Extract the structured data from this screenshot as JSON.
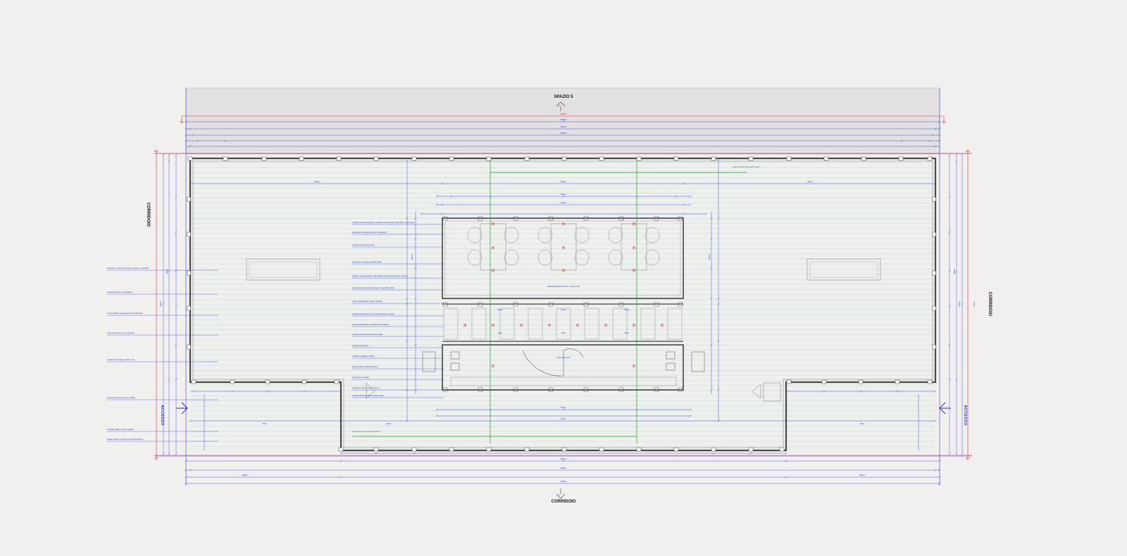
{
  "plan": {
    "labels": {
      "top": "SPAZIO 5",
      "bottom": "CORRIDOIO",
      "left": "CORRIDOIO",
      "right": "CORRIDOIO",
      "access_left": "ACCESSO",
      "access_right": "ACCESSO",
      "section_marker": "A",
      "room_center": "SPAZIO ESPOSITIVO / SALOTTO",
      "room_lower": "RIPOSTIGLIO"
    },
    "dimensions": {
      "overall_width": "1690cm",
      "overall_width_red": "1690cm",
      "inner_width": "1660cm",
      "inner_width_2": "1630cm",
      "left_span": "420cm",
      "center_span": "560cm",
      "right_span": "420cm",
      "bottom_left": "1820cm",
      "bottom_right": "1690cm",
      "height_total": "792cm",
      "height_inner": "748cm",
      "height_red": "800cm",
      "margin_small": "20cm",
      "module": "120cm",
      "module_b": "90cm",
      "module_c": "60cm",
      "stand_width": "560cm",
      "stand_inner": "520cm",
      "stand_depth": "330cm",
      "table_gap": "100cm"
    },
    "notes_left": [
      "pannello in lamiera forata / pannello in Green Arte / pannello in Green Arte",
      "pavimento in Ecoway (finiture metalliche)",
      "mobile pensile con luci led",
      "pavimento in rovere naturale chiaro",
      "parete in vetro pannello a filo Abitat con elementi di telaio in legno",
      "lamiera di rivestimento ignifuga / colore RAL 9003",
      "tavolo rettangolare in legno naturale",
      "rivestimento acustico per pannelli divisori a parete",
      "seduta polipropilene e acciaio colore bianco",
      "lampade da tavolo a led dimmerabili",
      "armadio a due ante",
      "scaffale modulare in legno",
      "tenda a rullo in tessuto tecnico",
      "corrimano in acciaio",
      "struttura a rullo in tessuto tecnico",
      "pannello fonoassorbente colore grigio"
    ],
    "notes_far_left": [
      "pavimento in tavole di rovere naturale cm 20x200",
      "parete divisoria in cartongesso",
      "controsoffitto in cartongesso con faretti led",
      "porta scorrevole in vetro satinato",
      "rivestimento in legno colore noce",
      "illuminazione lineare led a soffitto",
      "pannello grafico stampa digitale",
      "parete a telaio in legno con tamponamento"
    ],
    "notes_green": [
      "linea di sezione prospetto interno",
      "linea di sezione prospetto interno"
    ]
  }
}
